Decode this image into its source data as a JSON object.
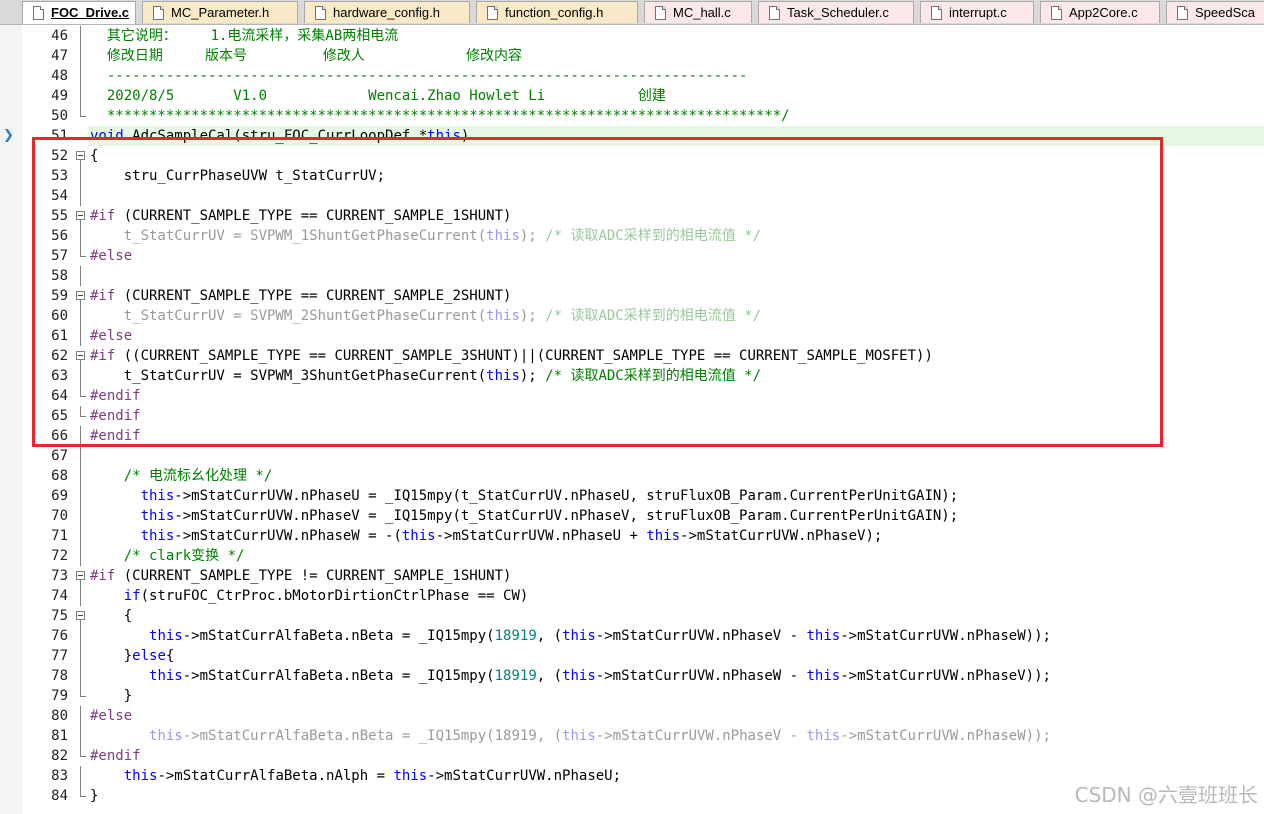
{
  "tabs": [
    {
      "label": "FOC_Drive.c",
      "type": "c",
      "active": true
    },
    {
      "label": "MC_Parameter.h",
      "type": "h",
      "active": false
    },
    {
      "label": "hardware_config.h",
      "type": "h",
      "active": false
    },
    {
      "label": "function_config.h",
      "type": "h",
      "active": false
    },
    {
      "label": "MC_hall.c",
      "type": "c",
      "active": false
    },
    {
      "label": "Task_Scheduler.c",
      "type": "c",
      "active": false
    },
    {
      "label": "interrupt.c",
      "type": "c",
      "active": false
    },
    {
      "label": "App2Core.c",
      "type": "c",
      "active": false
    },
    {
      "label": "SpeedSca",
      "type": "c",
      "active": false
    }
  ],
  "current_line": 51,
  "highlighted_range": {
    "from": 53,
    "to": 67
  },
  "lines": [
    {
      "n": 46,
      "fold": "line",
      "spans": [
        [
          "  其它说明：    1.电流采样，采集AB两相电流",
          "cm"
        ]
      ]
    },
    {
      "n": 47,
      "fold": "line",
      "spans": [
        [
          "  修改日期     版本号         修改人            修改内容",
          "cm"
        ]
      ]
    },
    {
      "n": 48,
      "fold": "line",
      "spans": [
        [
          "  ----------------------------------------------------------------------------",
          "cm"
        ]
      ]
    },
    {
      "n": 49,
      "fold": "line",
      "spans": [
        [
          "  2020/8/5       V1.0            Wencai.Zhao Howlet Li           创建",
          "cm"
        ]
      ]
    },
    {
      "n": 50,
      "fold": "end",
      "spans": [
        [
          "  ********************************************************************************/",
          "cm"
        ]
      ]
    },
    {
      "n": 51,
      "fold": "",
      "spans": [
        [
          "void",
          "kw"
        ],
        [
          " AdcSampleCal(stru_FOC_CurrLoopDef *",
          ""
        ],
        [
          "this",
          "kw"
        ],
        [
          ")",
          ""
        ]
      ]
    },
    {
      "n": 52,
      "fold": "box",
      "spans": [
        [
          "{",
          ""
        ]
      ]
    },
    {
      "n": 53,
      "fold": "line",
      "spans": [
        [
          "    stru_CurrPhaseUVW t_StatCurrUV;",
          ""
        ]
      ]
    },
    {
      "n": 54,
      "fold": "line",
      "spans": [
        [
          "",
          ""
        ]
      ]
    },
    {
      "n": 55,
      "fold": "box",
      "spans": [
        [
          "#if",
          "pp"
        ],
        [
          " (CURRENT_SAMPLE_TYPE == CURRENT_SAMPLE_1SHUNT)",
          ""
        ]
      ]
    },
    {
      "n": 56,
      "fold": "line",
      "spans": [
        [
          "    t_StatCurrUV = SVPWM_1ShuntGetPhaseCurrent(",
          "gray"
        ],
        [
          "this",
          "grayk"
        ],
        [
          ");",
          "gray"
        ],
        [
          " /* 读取ADC采样到的相电流值 */",
          "grayc"
        ]
      ]
    },
    {
      "n": 57,
      "fold": "end",
      "spans": [
        [
          "#else",
          "pp"
        ]
      ]
    },
    {
      "n": 58,
      "fold": "line",
      "spans": [
        [
          "",
          ""
        ]
      ]
    },
    {
      "n": 59,
      "fold": "box",
      "spans": [
        [
          "#if",
          "pp"
        ],
        [
          " (CURRENT_SAMPLE_TYPE == CURRENT_SAMPLE_2SHUNT)",
          ""
        ]
      ]
    },
    {
      "n": 60,
      "fold": "line",
      "spans": [
        [
          "    t_StatCurrUV = SVPWM_2ShuntGetPhaseCurrent(",
          "gray"
        ],
        [
          "this",
          "grayk"
        ],
        [
          ");",
          "gray"
        ],
        [
          " /* 读取ADC采样到的相电流值 */",
          "grayc"
        ]
      ]
    },
    {
      "n": 61,
      "fold": "line",
      "spans": [
        [
          "#else",
          "pp"
        ]
      ]
    },
    {
      "n": 62,
      "fold": "box",
      "spans": [
        [
          "#if",
          "pp"
        ],
        [
          " ((CURRENT_SAMPLE_TYPE == CURRENT_SAMPLE_3SHUNT)||(CURRENT_SAMPLE_TYPE == CURRENT_SAMPLE_MOSFET))",
          ""
        ]
      ]
    },
    {
      "n": 63,
      "fold": "line",
      "spans": [
        [
          "    t_StatCurrUV = SVPWM_3ShuntGetPhaseCurrent(",
          ""
        ],
        [
          "this",
          "kw"
        ],
        [
          ");",
          ""
        ],
        [
          " /* 读取ADC采样到的相电流值 */",
          "cm"
        ]
      ]
    },
    {
      "n": 64,
      "fold": "end",
      "spans": [
        [
          "#endif",
          "pp"
        ]
      ]
    },
    {
      "n": 65,
      "fold": "end",
      "spans": [
        [
          "#endif",
          "pp"
        ]
      ]
    },
    {
      "n": 66,
      "fold": "line",
      "spans": [
        [
          "#endif",
          "pp"
        ]
      ]
    },
    {
      "n": 67,
      "fold": "line",
      "spans": [
        [
          "",
          ""
        ]
      ]
    },
    {
      "n": 68,
      "fold": "line",
      "spans": [
        [
          "    /* 电流标幺化处理 */",
          "cm"
        ]
      ]
    },
    {
      "n": 69,
      "fold": "line",
      "spans": [
        [
          "      ",
          ""
        ],
        [
          "this",
          "kw"
        ],
        [
          "->mStatCurrUVW.nPhaseU = _IQ15mpy(t_StatCurrUV.nPhaseU, struFluxOB_Param.CurrentPerUnitGAIN);",
          ""
        ]
      ]
    },
    {
      "n": 70,
      "fold": "line",
      "spans": [
        [
          "      ",
          ""
        ],
        [
          "this",
          "kw"
        ],
        [
          "->mStatCurrUVW.nPhaseV = _IQ15mpy(t_StatCurrUV.nPhaseV, struFluxOB_Param.CurrentPerUnitGAIN);",
          ""
        ]
      ]
    },
    {
      "n": 71,
      "fold": "line",
      "spans": [
        [
          "      ",
          ""
        ],
        [
          "this",
          "kw"
        ],
        [
          "->mStatCurrUVW.nPhaseW = -(",
          ""
        ],
        [
          "this",
          "kw"
        ],
        [
          "->mStatCurrUVW.nPhaseU + ",
          ""
        ],
        [
          "this",
          "kw"
        ],
        [
          "->mStatCurrUVW.nPhaseV);",
          ""
        ]
      ]
    },
    {
      "n": 72,
      "fold": "line",
      "spans": [
        [
          "    /* clark变换 */",
          "cm"
        ]
      ]
    },
    {
      "n": 73,
      "fold": "box",
      "spans": [
        [
          "#if",
          "pp"
        ],
        [
          " (CURRENT_SAMPLE_TYPE != CURRENT_SAMPLE_1SHUNT)",
          ""
        ]
      ]
    },
    {
      "n": 74,
      "fold": "line",
      "spans": [
        [
          "    ",
          ""
        ],
        [
          "if",
          "kw"
        ],
        [
          "(struFOC_CtrProc.bMotorDirtionCtrlPhase == CW)",
          ""
        ]
      ]
    },
    {
      "n": 75,
      "fold": "box",
      "spans": [
        [
          "    {",
          ""
        ]
      ]
    },
    {
      "n": 76,
      "fold": "line",
      "spans": [
        [
          "       ",
          ""
        ],
        [
          "this",
          "kw"
        ],
        [
          "->mStatCurrAlfaBeta.nBeta = _IQ15mpy(",
          ""
        ],
        [
          "18919",
          "num"
        ],
        [
          ", (",
          ""
        ],
        [
          "this",
          "kw"
        ],
        [
          "->mStatCurrUVW.nPhaseV - ",
          ""
        ],
        [
          "this",
          "kw"
        ],
        [
          "->mStatCurrUVW.nPhaseW));",
          ""
        ]
      ]
    },
    {
      "n": 77,
      "fold": "line",
      "spans": [
        [
          "    }",
          ""
        ],
        [
          "else",
          "kw"
        ],
        [
          "{",
          ""
        ]
      ]
    },
    {
      "n": 78,
      "fold": "line",
      "spans": [
        [
          "       ",
          ""
        ],
        [
          "this",
          "kw"
        ],
        [
          "->mStatCurrAlfaBeta.nBeta = _IQ15mpy(",
          ""
        ],
        [
          "18919",
          "num"
        ],
        [
          ", (",
          ""
        ],
        [
          "this",
          "kw"
        ],
        [
          "->mStatCurrUVW.nPhaseW - ",
          ""
        ],
        [
          "this",
          "kw"
        ],
        [
          "->mStatCurrUVW.nPhaseV));",
          ""
        ]
      ]
    },
    {
      "n": 79,
      "fold": "end",
      "spans": [
        [
          "    }",
          ""
        ]
      ]
    },
    {
      "n": 80,
      "fold": "line",
      "spans": [
        [
          "#else",
          "pp"
        ]
      ]
    },
    {
      "n": 81,
      "fold": "line",
      "spans": [
        [
          "       ",
          ""
        ],
        [
          "this",
          "grayk"
        ],
        [
          "->mStatCurrAlfaBeta.nBeta = _IQ15mpy(",
          "gray"
        ],
        [
          "18919",
          "gray"
        ],
        [
          ", (",
          "gray"
        ],
        [
          "this",
          "grayk"
        ],
        [
          "->mStatCurrUVW.nPhaseV - ",
          "gray"
        ],
        [
          "this",
          "grayk"
        ],
        [
          "->mStatCurrUVW.nPhaseW));",
          "gray"
        ]
      ]
    },
    {
      "n": 82,
      "fold": "end",
      "spans": [
        [
          "#endif",
          "pp"
        ]
      ]
    },
    {
      "n": 83,
      "fold": "line",
      "spans": [
        [
          "    ",
          ""
        ],
        [
          "this",
          "kw"
        ],
        [
          "->mStatCurrAlfaBeta.nAlph = ",
          ""
        ],
        [
          "this",
          "kw"
        ],
        [
          "->mStatCurrUVW.nPhaseU;",
          ""
        ]
      ]
    },
    {
      "n": 84,
      "fold": "end",
      "spans": [
        [
          "}",
          ""
        ]
      ]
    }
  ],
  "watermark": "CSDN @六壹班班长"
}
